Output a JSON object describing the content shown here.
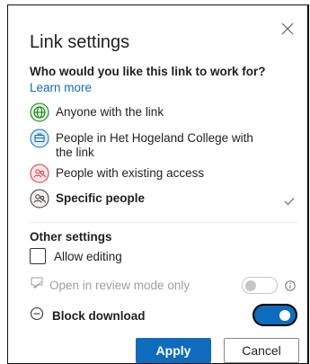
{
  "dialog": {
    "title": "Link settings",
    "question": "Who would you like this link to work for?",
    "learn_more": "Learn more",
    "options": [
      {
        "label": "Anyone with the link",
        "icon": "globe-icon",
        "color": "#107c10",
        "selected": false
      },
      {
        "label": "People in Het Hogeland College with the link",
        "icon": "building-icon",
        "color": "#0f6cbd",
        "selected": false
      },
      {
        "label": "People with existing access",
        "icon": "people-icon",
        "color": "#d13438",
        "selected": false
      },
      {
        "label": "Specific people",
        "icon": "people-icon",
        "color": "#323130",
        "selected": true
      }
    ],
    "selected_mark": "checkmark-icon"
  },
  "other_settings": {
    "title": "Other settings",
    "allow_editing": {
      "label": "Allow editing",
      "checked": false
    },
    "review_mode": {
      "label": "Open in review mode only",
      "enabled": false,
      "on": false,
      "icon": "review-icon"
    },
    "block_download": {
      "label": "Block download",
      "on": true,
      "icon": "block-icon"
    }
  },
  "buttons": {
    "apply": "Apply",
    "cancel": "Cancel"
  },
  "colors": {
    "accent": "#0f6cbd",
    "text": "#201f1e",
    "disabled": "#a19f9d"
  }
}
